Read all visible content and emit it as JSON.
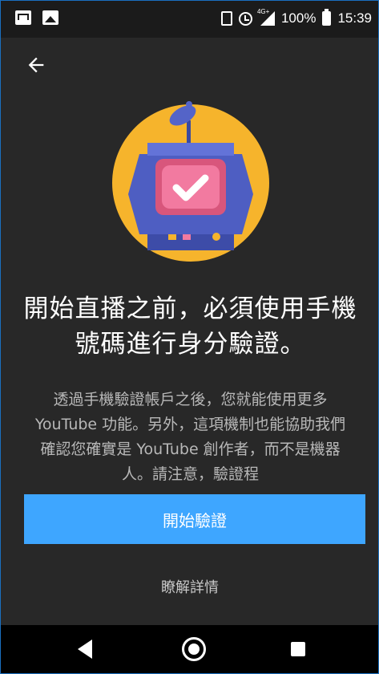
{
  "status_bar": {
    "network": "4G+",
    "battery": "100%",
    "time": "15:39"
  },
  "content": {
    "title": "開始直播之前，必須使用手機號碼進行身分驗證。",
    "body": "透過手機驗證帳戶之後，您就能使用更多 YouTube 功能。另外，這項機制也能協助我們確認您確實是 YouTube 創作者，而不是機器人。請注意，驗證程"
  },
  "actions": {
    "primary_label": "開始驗證",
    "secondary_label": "瞭解詳情"
  },
  "colors": {
    "background": "#282828",
    "primary_button": "#3ea6ff",
    "illustration_circle": "#f6b42c"
  }
}
